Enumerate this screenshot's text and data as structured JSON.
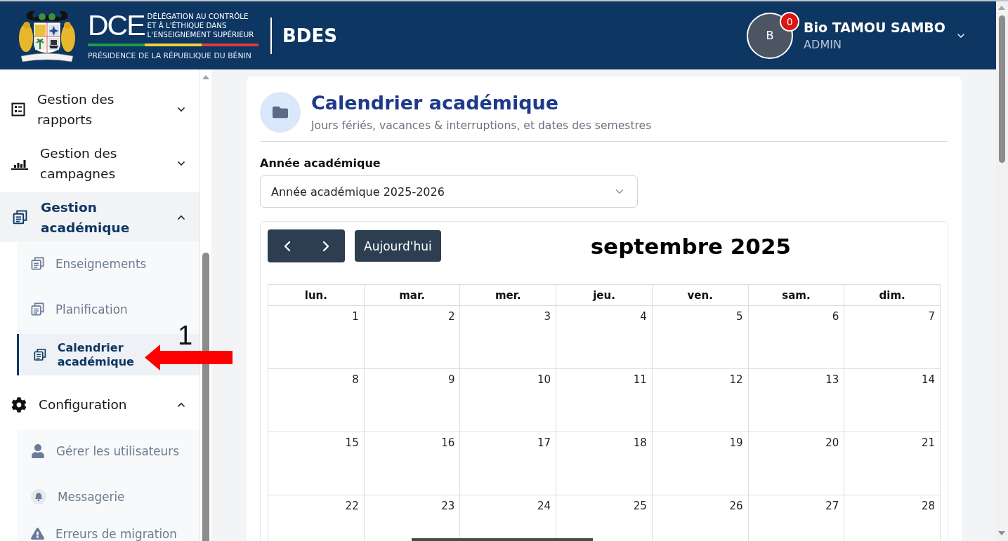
{
  "header": {
    "logo": {
      "acronym": "DCE",
      "name_lines": [
        "DÉLÉGATION AU CONTRÔLE",
        "ET À L'ÉTHIQUE DANS",
        "L'ENSEIGNEMENT SUPÉRIEUR"
      ],
      "tagline": "PRÉSIDENCE DE LA RÉPUBLIQUE DU BÉNIN"
    },
    "app_name": "BDES",
    "user": {
      "initial": "B",
      "notification_count": "0",
      "name": "Bio TAMOU SAMBO",
      "role": "ADMIN"
    }
  },
  "sidebar": {
    "items": [
      {
        "label": "Gestion des rapports",
        "expanded": false,
        "active": false
      },
      {
        "label": "Gestion des campagnes",
        "expanded": false,
        "active": false
      },
      {
        "label": "Gestion académique",
        "expanded": true,
        "active": true,
        "children": [
          {
            "label": "Enseignements",
            "selected": false
          },
          {
            "label": "Planification",
            "selected": false
          },
          {
            "label": "Calendrier académique",
            "selected": true
          }
        ]
      },
      {
        "label": "Configuration",
        "expanded": true,
        "active": false,
        "children": [
          {
            "label": "Gérer les utilisateurs",
            "selected": false
          },
          {
            "label": "Messagerie",
            "selected": false
          },
          {
            "label": "Erreurs de migration",
            "selected": false
          }
        ]
      }
    ]
  },
  "page": {
    "title": "Calendrier académique",
    "subtitle": "Jours fériés, vacances & interruptions, et dates des semestres",
    "year_field": {
      "label": "Année académique",
      "value": "Année académique 2025-2026"
    },
    "calendar": {
      "today_button": "Aujourd'hui",
      "title": "septembre 2025",
      "weekdays": [
        "lun.",
        "mar.",
        "mer.",
        "jeu.",
        "ven.",
        "sam.",
        "dim."
      ],
      "weeks": [
        [
          "1",
          "2",
          "3",
          "4",
          "5",
          "6",
          "7"
        ],
        [
          "8",
          "9",
          "10",
          "11",
          "12",
          "13",
          "14"
        ],
        [
          "15",
          "16",
          "17",
          "18",
          "19",
          "20",
          "21"
        ],
        [
          "22",
          "23",
          "24",
          "25",
          "26",
          "27",
          "28"
        ]
      ]
    }
  },
  "annotation": {
    "number": "1"
  }
}
